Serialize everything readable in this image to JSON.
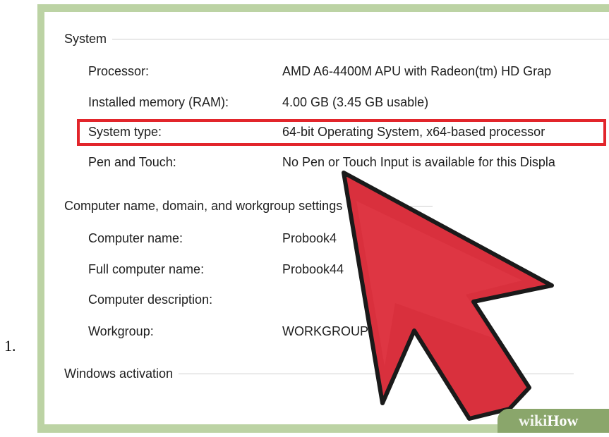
{
  "step": {
    "number": "1."
  },
  "system": {
    "header": "System",
    "rows": [
      {
        "label": "Processor:",
        "value": "AMD A6-4400M APU with Radeon(tm) HD Grap"
      },
      {
        "label": "Installed memory (RAM):",
        "value": "4.00 GB (3.45 GB usable)"
      },
      {
        "label": "System type:",
        "value": "64-bit Operating System, x64-based processor"
      },
      {
        "label": "Pen and Touch:",
        "value": "No Pen or Touch Input is available for this Displa"
      }
    ]
  },
  "computer_name": {
    "header": "Computer name, domain, and workgroup settings",
    "rows": [
      {
        "label": "Computer name:",
        "value": "Probook4"
      },
      {
        "label": "Full computer name:",
        "value": "Probook44"
      },
      {
        "label": "Computer description:",
        "value": ""
      },
      {
        "label": "Workgroup:",
        "value": "WORKGROUP"
      }
    ]
  },
  "activation": {
    "header": "Windows activation"
  },
  "watermark": {
    "wiki": "wiki",
    "how": "How"
  },
  "colors": {
    "frame": "#bcd3a4",
    "highlight": "#e2252b",
    "arrow_fill": "#d9303d",
    "arrow_stroke": "#1a1a1a"
  },
  "icons": {
    "pointer": "cursor-arrow-icon"
  }
}
